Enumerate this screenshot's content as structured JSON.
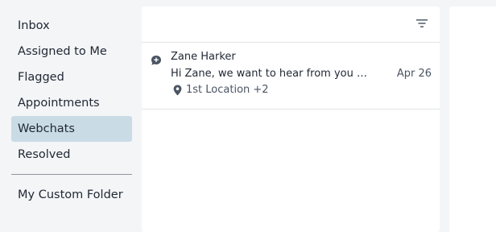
{
  "sidebar": {
    "items": [
      {
        "label": "Inbox"
      },
      {
        "label": "Assigned to Me"
      },
      {
        "label": "Flagged"
      },
      {
        "label": "Appointments"
      },
      {
        "label": "Webchats",
        "active": true
      },
      {
        "label": "Resolved"
      }
    ],
    "custom_folders": [
      {
        "label": "My Custom Folder"
      }
    ]
  },
  "conversation_list": {
    "filter_icon": "filter-icon",
    "items": [
      {
        "icon": "chat-bubble-icon",
        "name": "Zane Harker",
        "preview": "Hi Zane, we want to hear from you about your recent visit",
        "date": "Apr 26",
        "location_icon": "location-pin-icon",
        "location": "1st Location +2"
      }
    ]
  },
  "colors": {
    "active_nav_bg": "#c9dce6",
    "page_bg": "#f4f5f7",
    "panel_bg": "#ffffff",
    "text": "#1f2733",
    "muted_text": "#4b5563"
  }
}
